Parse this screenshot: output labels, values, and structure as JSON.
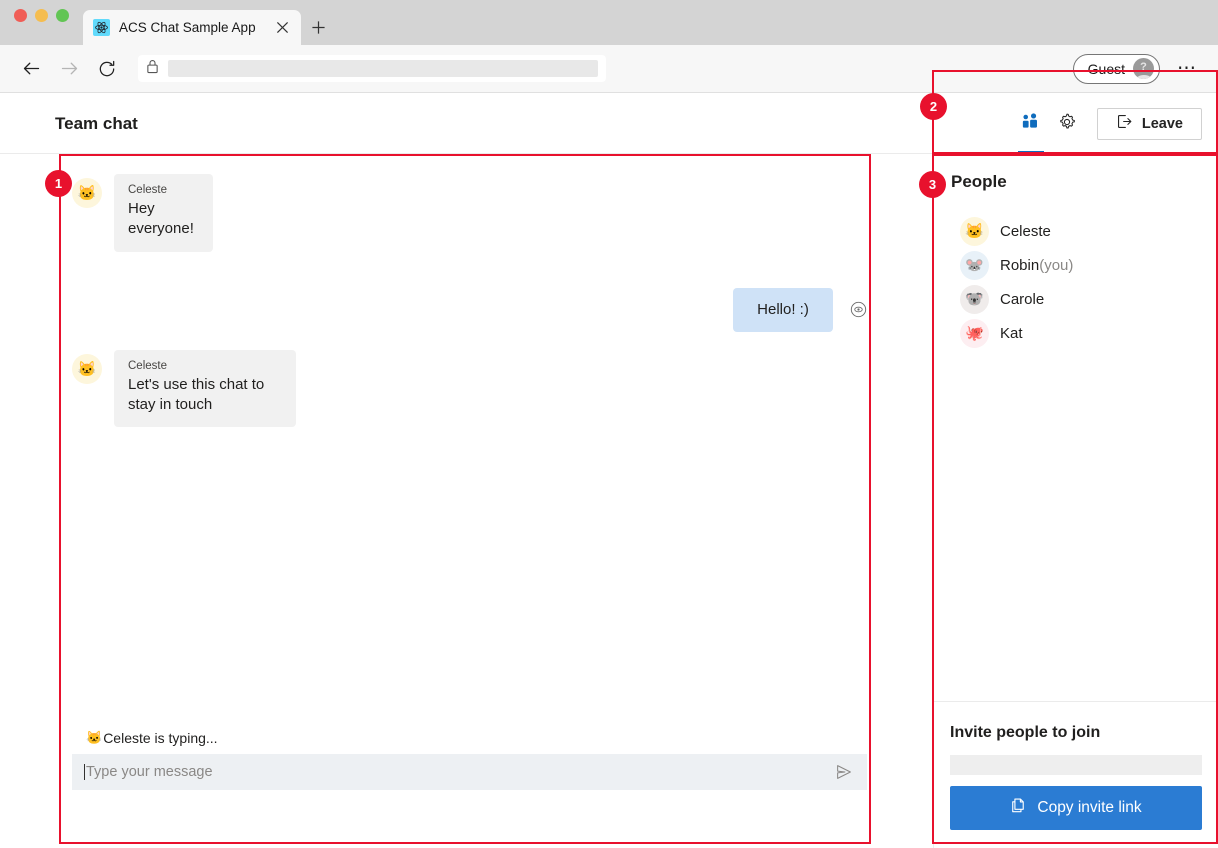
{
  "browser": {
    "tab": {
      "title": "ACS Chat Sample App",
      "favicon_icon": "react-logo-icon",
      "close_icon": "close-icon"
    },
    "new_tab_icon": "plus-icon",
    "back_icon": "arrow-left-icon",
    "forward_icon": "arrow-right-icon",
    "reload_icon": "reload-icon",
    "lock_icon": "lock-icon",
    "address_value": "",
    "address_placeholder": "",
    "profile": {
      "label": "Guest",
      "avatar_icon": "guest-avatar-icon"
    },
    "menu_icon": "ellipsis-icon"
  },
  "chat": {
    "title": "Team chat",
    "messages": [
      {
        "id": "m1",
        "sender": "Celeste",
        "text": "Hey everyone!",
        "mine": false,
        "avatar_glyph": "🐱",
        "avatar_bg": "#fdf6dc"
      },
      {
        "id": "m2",
        "sender": "",
        "text": "Hello! :)",
        "mine": true,
        "status_icon": "seen-icon"
      },
      {
        "id": "m3",
        "sender": "Celeste",
        "text": "Let's use this chat to stay in touch",
        "mine": false,
        "avatar_glyph": "🐱",
        "avatar_bg": "#fdf6dc"
      }
    ],
    "typing_emoji": "🐱",
    "typing_text": "Celeste is typing...",
    "composer_placeholder": "Type your message",
    "composer_value": "",
    "send_icon": "send-icon"
  },
  "panel": {
    "people_tab_icon": "people-icon",
    "settings_tab_icon": "gear-icon",
    "leave": {
      "label": "Leave",
      "icon": "sign-out-icon"
    },
    "people_title": "People",
    "people": [
      {
        "name": "Celeste",
        "suffix": "",
        "glyph": "🐱",
        "bg": "#fdf6dc"
      },
      {
        "name": "Robin",
        "suffix": "(you)",
        "glyph": "🐭",
        "bg": "#e8f1f8"
      },
      {
        "name": "Carole",
        "suffix": "",
        "glyph": "🐨",
        "bg": "#f0eceb"
      },
      {
        "name": "Kat",
        "suffix": "",
        "glyph": "🐙",
        "bg": "#fdeef1"
      }
    ],
    "invite_title": "Invite people to join",
    "invite_value": "",
    "copy_button": {
      "label": "Copy invite link",
      "icon": "copy-icon"
    }
  },
  "annotations": {
    "accent": "#e8112d",
    "badges": [
      {
        "id": "1",
        "label": "1"
      },
      {
        "id": "2",
        "label": "2"
      },
      {
        "id": "3",
        "label": "3"
      }
    ]
  },
  "colors": {
    "brand_blue": "#0f6cbd",
    "copy_button_blue": "#2b7cd3",
    "my_bubble": "#cfe2f7",
    "their_bubble": "#f1f1f1",
    "annotation_red": "#e8112d"
  }
}
